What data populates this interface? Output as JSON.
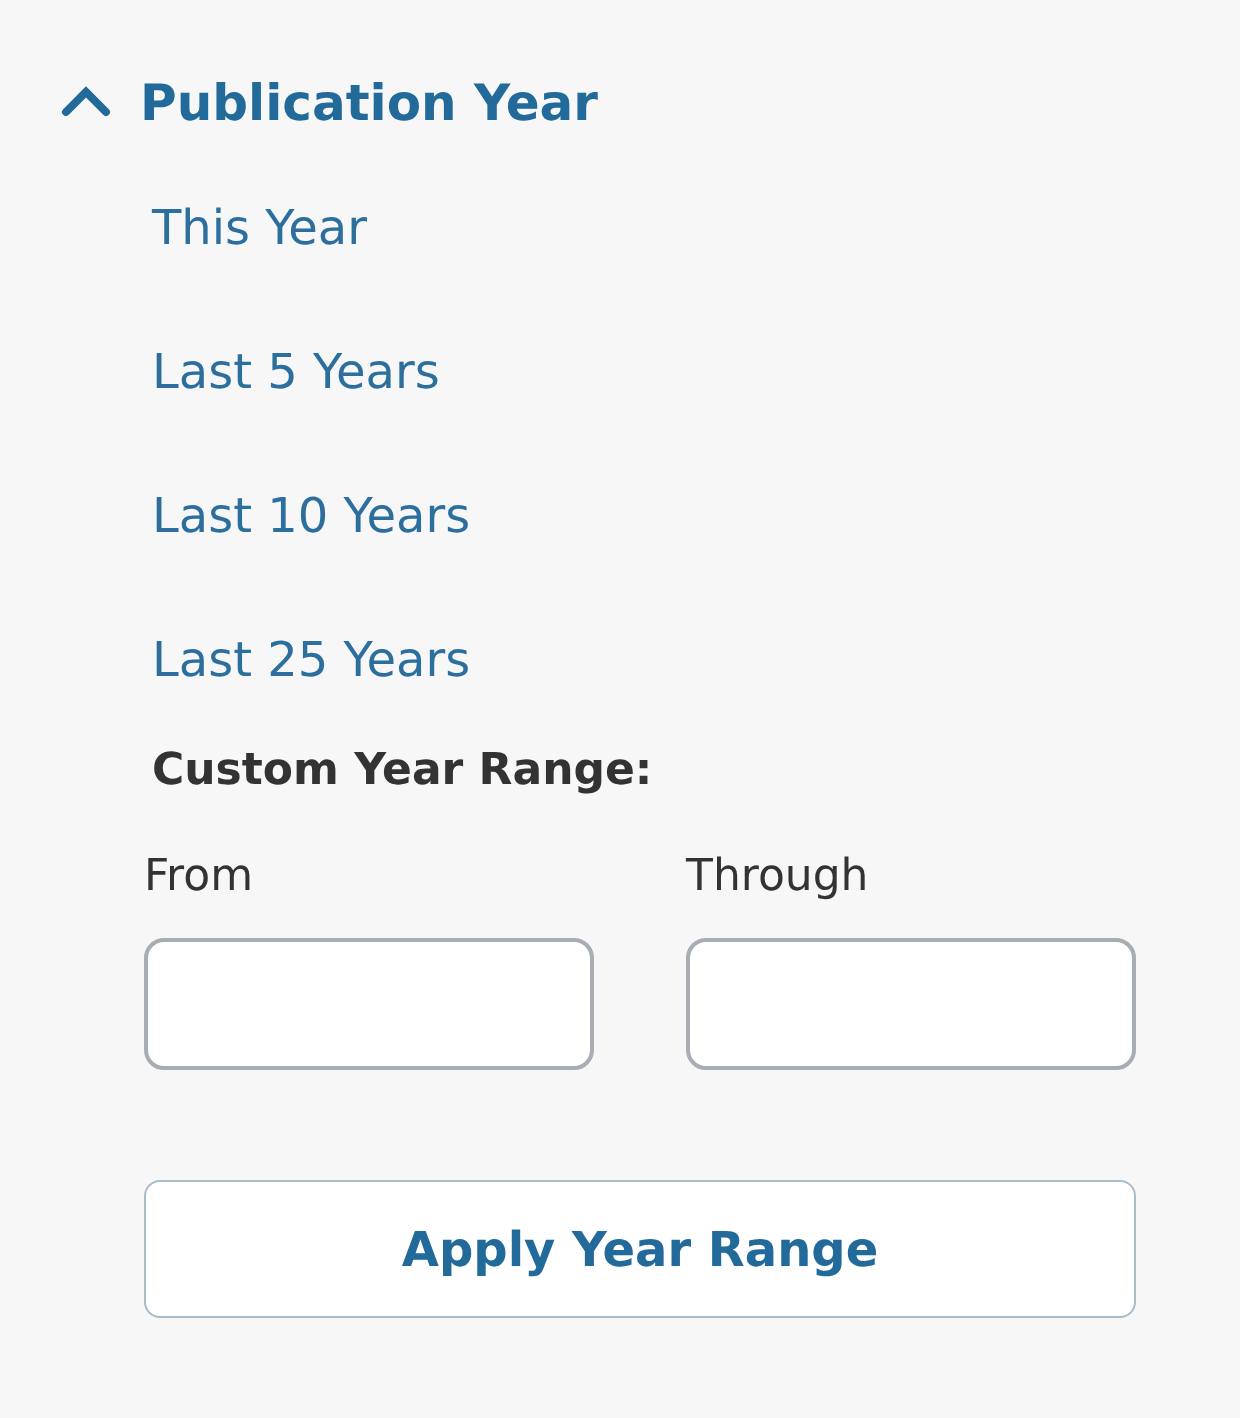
{
  "filter": {
    "title": "Publication Year",
    "expanded": true
  },
  "options": [
    {
      "label": "This Year"
    },
    {
      "label": "Last 5 Years"
    },
    {
      "label": "Last 10 Years"
    },
    {
      "label": "Last 25 Years"
    }
  ],
  "custom_range": {
    "title": "Custom Year Range:",
    "fields": [
      {
        "label": "From"
      },
      {
        "label": "Through"
      }
    ],
    "button": "Apply Year Range"
  }
}
